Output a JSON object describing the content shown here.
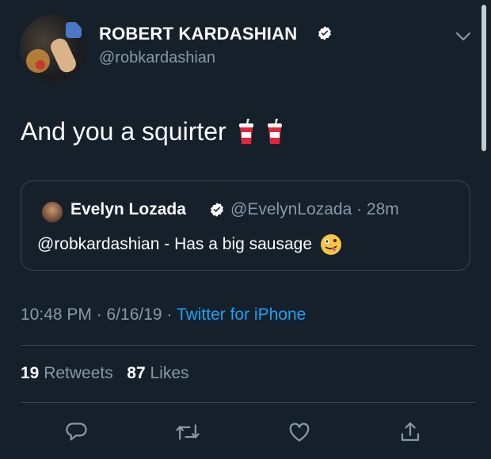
{
  "author": {
    "name": "ROBERT KARDASHIAN",
    "handle": "@robkardashian",
    "verified": true
  },
  "tweet": {
    "text": "And you a squirter",
    "emoji": [
      "cup-with-straw",
      "cup-with-straw"
    ]
  },
  "quoted_tweet": {
    "name": "Evelyn Lozada",
    "handle_time": "@EvelynLozada · 28m",
    "text": "@robkardashian - Has a big sausage",
    "emoji": "zany-face"
  },
  "meta": {
    "time_date": "10:48 PM · 6/16/19 · ",
    "source": "Twitter for iPhone"
  },
  "stats": {
    "retweets_count": "19",
    "retweets_label": "Retweets",
    "likes_count": "87",
    "likes_label": "Likes"
  },
  "actions": [
    "reply-icon",
    "retweet-icon",
    "like-icon",
    "share-icon"
  ],
  "colors": {
    "background": "#15202b",
    "secondary_text": "#8899a6",
    "link": "#1da1f2",
    "divider": "#38444d"
  }
}
